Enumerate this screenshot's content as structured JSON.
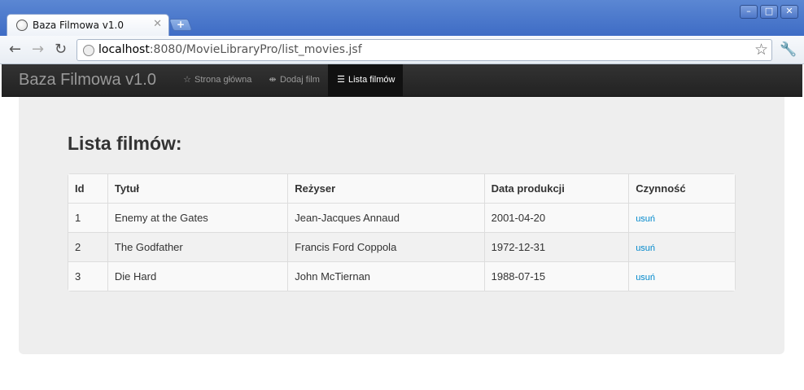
{
  "browser": {
    "tab_title": "Baza Filmowa v1.0",
    "new_tab_icon": "plus-icon",
    "url_host": "localhost",
    "url_rest": ":8080/MovieLibraryPro/list_movies.jsf",
    "window_controls": [
      "minimize",
      "maximize",
      "close"
    ]
  },
  "navbar": {
    "brand": "Baza Filmowa v1.0",
    "items": [
      {
        "icon": "star-icon",
        "label": "Strona główna"
      },
      {
        "icon": "move-icon",
        "label": "Dodaj film"
      },
      {
        "icon": "list-icon",
        "label": "Lista filmów",
        "active": true
      }
    ]
  },
  "page": {
    "title": "Lista filmów:"
  },
  "table": {
    "headers": [
      "Id",
      "Tytuł",
      "Reżyser",
      "Data produkcji",
      "Czynność"
    ],
    "rows": [
      {
        "id": "1",
        "title": "Enemy at the Gates",
        "director": "Jean-Jacques Annaud",
        "date": "2001-04-20",
        "action": "usuń"
      },
      {
        "id": "2",
        "title": "The Godfather",
        "director": "Francis Ford Coppola",
        "date": "1972-12-31",
        "action": "usuń"
      },
      {
        "id": "3",
        "title": "Die Hard",
        "director": "John McTiernan",
        "date": "1988-07-15",
        "action": "usuń"
      }
    ]
  },
  "colors": {
    "navbar_bg": "#222222",
    "hero_bg": "#eeeeee",
    "link": "#0088cc"
  }
}
